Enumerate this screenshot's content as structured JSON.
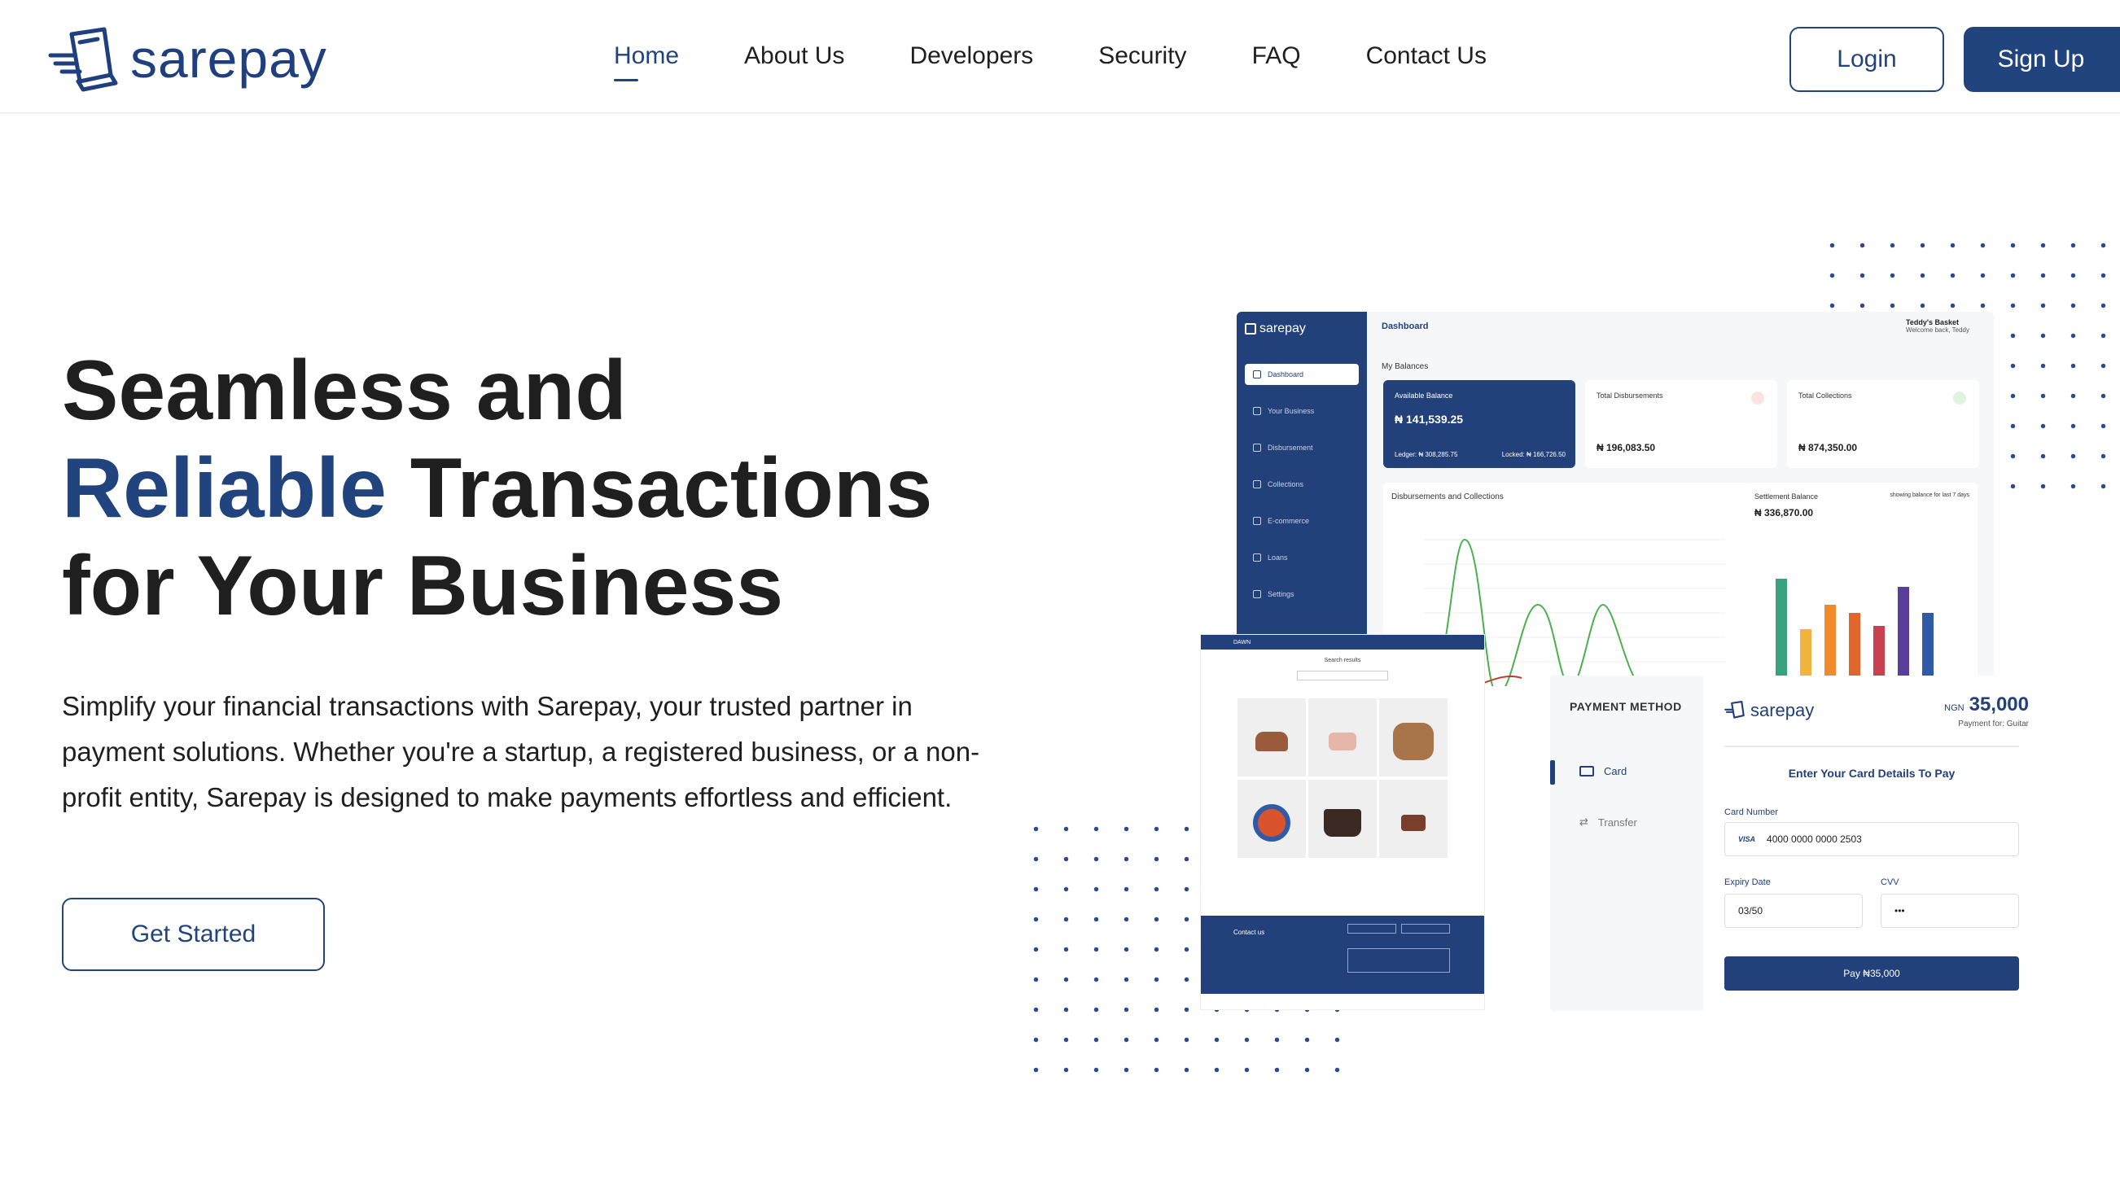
{
  "header": {
    "logo_text": "sarepay",
    "nav": [
      "Home",
      "About Us",
      "Developers",
      "Security",
      "FAQ",
      "Contact Us"
    ],
    "active_nav": "Home",
    "login_label": "Login",
    "signup_label": "Sign Up"
  },
  "hero": {
    "title_line1": "Seamless and",
    "title_accent": "Reliable",
    "title_line2_rest": " Transactions",
    "title_line3": "for Your Business",
    "description": "Simplify your financial transactions with Sarepay, your trusted partner in payment solutions. Whether you're a startup, a registered business, or a non-profit entity, Sarepay is designed to make payments effortless and efficient.",
    "cta_label": "Get Started"
  },
  "dashboard": {
    "logo": "sarepay",
    "title": "Dashboard",
    "user_name": "Teddy's Basket",
    "user_welcome": "Welcome back, Teddy",
    "sidebar": [
      "Dashboard",
      "Your Business",
      "Disbursement",
      "Collections",
      "E-commerce",
      "Loans",
      "Settings"
    ],
    "balances_label": "My Balances",
    "available_label": "Available Balance",
    "available_value": "₦ 141,539.25",
    "ledger": "Ledger: ₦ 308,285.75",
    "locked": "Locked: ₦ 166,726.50",
    "disb_label": "Total Disbursements",
    "disb_value": "₦ 196,083.50",
    "coll_label": "Total Collections",
    "coll_value": "₦ 874,350.00",
    "chart_title": "Disbursements and Collections",
    "settle_title": "Settlement Balance",
    "settle_value": "₦ 336,870.00",
    "settle_note": "showing balance for last 7 days",
    "colors": {
      "primary": "#22407a",
      "green": "#4caf50",
      "red": "#c0392b"
    }
  },
  "shop": {
    "bar_text": "DAWN",
    "search_label": "Search results",
    "contact_label": "Contact us"
  },
  "payment_method": {
    "title": "PAYMENT METHOD",
    "options": [
      "Card",
      "Transfer"
    ],
    "selected": "Card"
  },
  "card_form": {
    "logo": "sarepay",
    "currency": "NGN",
    "amount": "35,000",
    "payment_for": "Payment for: Guitar",
    "heading": "Enter Your Card Details To Pay",
    "card_number_label": "Card Number",
    "card_number": "4000 0000 0000 2503",
    "card_brand": "VISA",
    "expiry_label": "Expiry Date",
    "expiry": "03/50",
    "cvv_label": "CVV",
    "cvv": "•••",
    "pay_label": "Pay ₦35,000"
  }
}
